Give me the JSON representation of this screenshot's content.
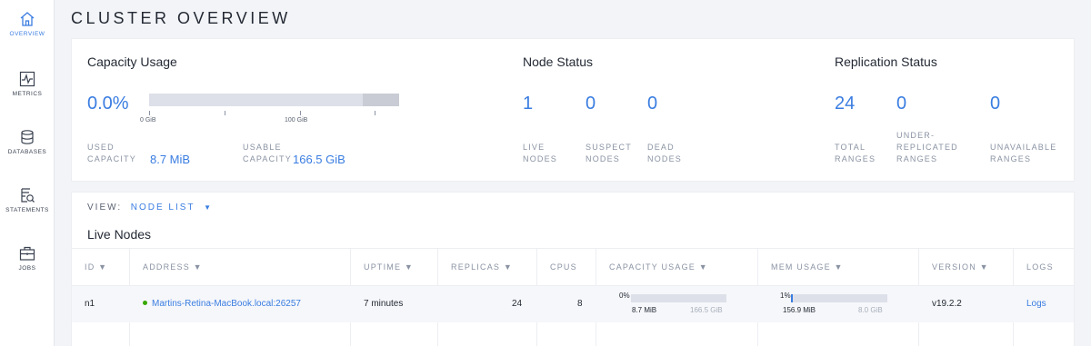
{
  "nav": [
    {
      "label": "OVERVIEW",
      "icon": "home-icon",
      "active": true
    },
    {
      "label": "METRICS",
      "icon": "metrics-icon"
    },
    {
      "label": "DATABASES",
      "icon": "database-icon"
    },
    {
      "label": "STATEMENTS",
      "icon": "statements-icon"
    },
    {
      "label": "JOBS",
      "icon": "jobs-icon"
    }
  ],
  "page_title": "CLUSTER OVERVIEW",
  "capacity": {
    "title": "Capacity Usage",
    "percent": "0.0%",
    "axis_0": "0 GiB",
    "axis_100": "100 GiB",
    "used_label_1": "USED",
    "used_label_2": "CAPACITY",
    "used_value": "8.7 MiB",
    "usable_label_1": "USABLE",
    "usable_label_2": "CAPACITY",
    "usable_value": "166.5 GiB"
  },
  "node_status": {
    "title": "Node Status",
    "live": "1",
    "suspect": "0",
    "dead": "0",
    "live_l1": "LIVE",
    "live_l2": "NODES",
    "suspect_l1": "SUSPECT",
    "suspect_l2": "NODES",
    "dead_l1": "DEAD",
    "dead_l2": "NODES"
  },
  "replication": {
    "title": "Replication Status",
    "total": "24",
    "under": "0",
    "unavailable": "0",
    "total_l1": "TOTAL",
    "total_l2": "RANGES",
    "under_l1": "UNDER-",
    "under_l2": "REPLICATED",
    "under_l3": "RANGES",
    "unavail_l1": "UNAVAILABLE",
    "unavail_l2": "RANGES"
  },
  "view": {
    "label": "VIEW:",
    "value": "NODE LIST"
  },
  "live_nodes_title": "Live Nodes",
  "columns": {
    "id": "ID ▼",
    "address": "ADDRESS ▼",
    "uptime": "UPTIME ▼",
    "replicas": "REPLICAS ▼",
    "cpus": "CPUS",
    "capacity": "CAPACITY USAGE ▼",
    "mem": "MEM USAGE ▼",
    "version": "VERSION ▼",
    "logs": "LOGS"
  },
  "row": {
    "id": "n1",
    "address": "Martins-Retina-MacBook.local:26257",
    "uptime": "7 minutes",
    "replicas": "24",
    "cpus": "8",
    "cap_pct": "0%",
    "cap_used": "8.7 MiB",
    "cap_total": "166.5 GiB",
    "mem_pct": "1%",
    "mem_used": "156.9 MiB",
    "mem_total": "8.0 GiB",
    "version": "v19.2.2",
    "logs": "Logs"
  },
  "colors": {
    "accent": "#3a7de1",
    "live_dot": "#37a806"
  }
}
